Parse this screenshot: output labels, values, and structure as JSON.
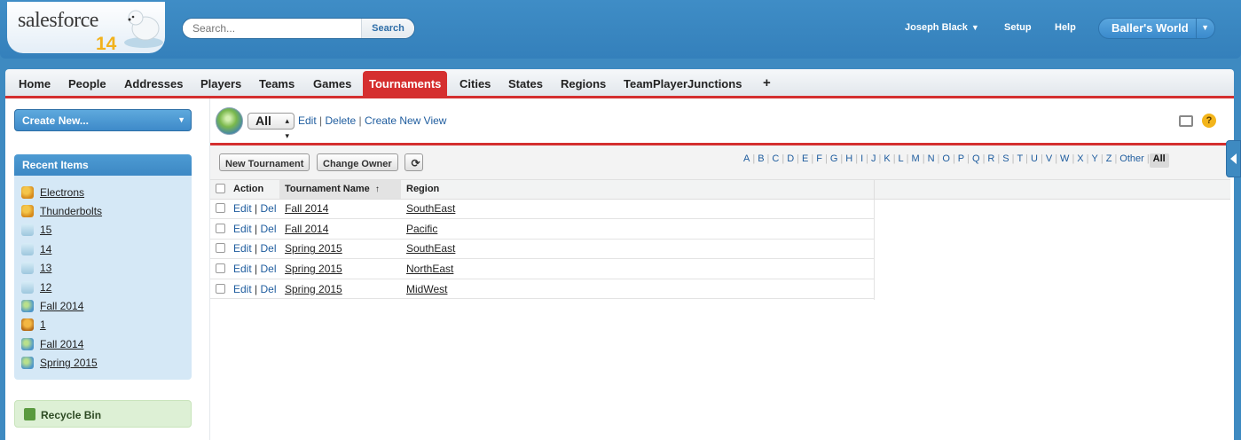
{
  "header": {
    "logo_text": "salesforce",
    "logo_version": "14",
    "search_placeholder": "Search...",
    "search_button": "Search",
    "user_name": "Joseph Black",
    "setup": "Setup",
    "help": "Help",
    "app_name": "Baller's World"
  },
  "tabs": [
    {
      "label": "Home"
    },
    {
      "label": "People"
    },
    {
      "label": "Addresses"
    },
    {
      "label": "Players"
    },
    {
      "label": "Teams"
    },
    {
      "label": "Games"
    },
    {
      "label": "Tournaments",
      "active": true
    },
    {
      "label": "Cities"
    },
    {
      "label": "States"
    },
    {
      "label": "Regions"
    },
    {
      "label": "TeamPlayerJunctions"
    },
    {
      "label": "+"
    }
  ],
  "sidebar": {
    "create_new": "Create New...",
    "recent_title": "Recent Items",
    "recent_items": [
      {
        "label": "Electrons",
        "icon": "person-icon"
      },
      {
        "label": "Thunderbolts",
        "icon": "person-icon"
      },
      {
        "label": "15",
        "icon": "ice-icon"
      },
      {
        "label": "14",
        "icon": "ice-icon"
      },
      {
        "label": "13",
        "icon": "ice-icon"
      },
      {
        "label": "12",
        "icon": "ice-icon"
      },
      {
        "label": "Fall 2014",
        "icon": "globe-icon"
      },
      {
        "label": "1",
        "icon": "trophy-icon"
      },
      {
        "label": "Fall 2014",
        "icon": "globe-icon"
      },
      {
        "label": "Spring 2015",
        "icon": "globe-icon"
      }
    ],
    "recycle_bin": "Recycle Bin"
  },
  "view": {
    "selected": "All",
    "edit": "Edit",
    "delete": "Delete",
    "create": "Create New View"
  },
  "toolbar": {
    "new_button": "New Tournament",
    "change_owner": "Change Owner"
  },
  "alphabet": [
    "A",
    "B",
    "C",
    "D",
    "E",
    "F",
    "G",
    "H",
    "I",
    "J",
    "K",
    "L",
    "M",
    "N",
    "O",
    "P",
    "Q",
    "R",
    "S",
    "T",
    "U",
    "V",
    "W",
    "X",
    "Y",
    "Z",
    "Other",
    "All"
  ],
  "table": {
    "columns": [
      "Action",
      "Tournament Name",
      "Region"
    ],
    "sort_indicator": "↑",
    "action_edit": "Edit",
    "action_del": "Del",
    "rows": [
      {
        "name": "Fall 2014",
        "region": "SouthEast"
      },
      {
        "name": "Fall 2014",
        "region": "Pacific"
      },
      {
        "name": "Spring 2015",
        "region": "SouthEast"
      },
      {
        "name": "Spring 2015",
        "region": "NorthEast"
      },
      {
        "name": "Spring 2015",
        "region": "MidWest"
      }
    ]
  },
  "colors": {
    "header_blue": "#3a86c0",
    "active_tab_red": "#d52f2f",
    "link_blue": "#1e5c9e"
  }
}
